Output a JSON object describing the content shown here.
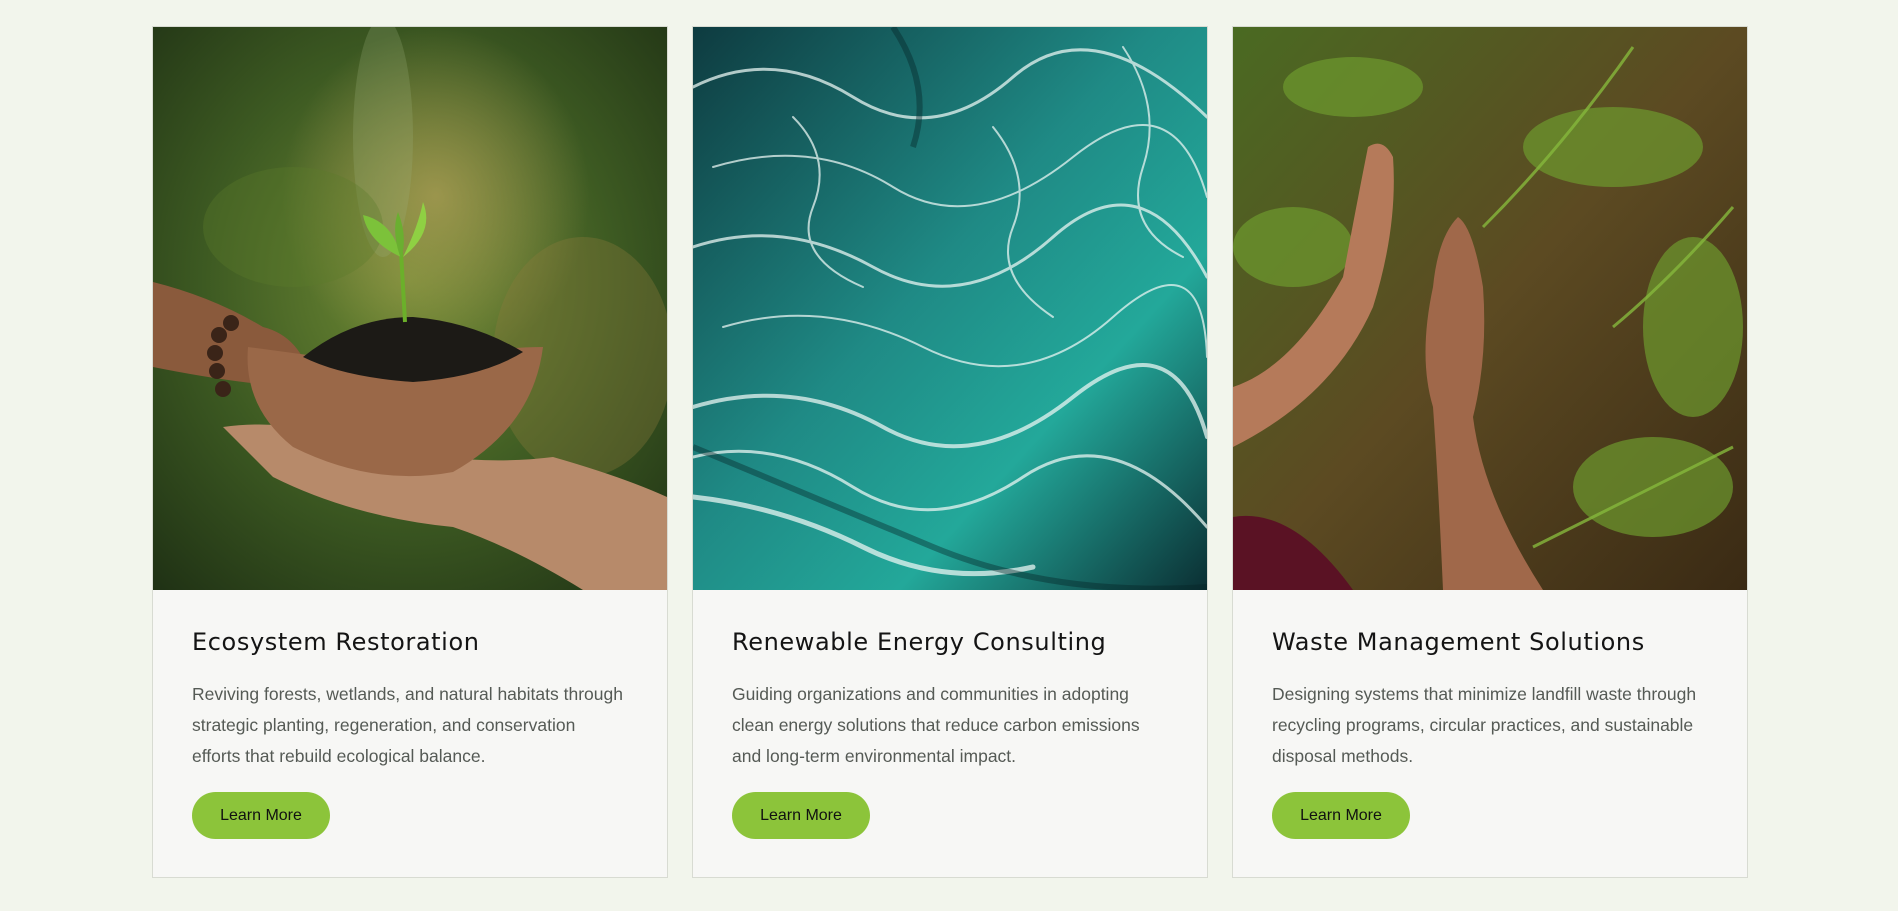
{
  "services": [
    {
      "image_alt": "Hands holding soil with a green seedling",
      "title": "Ecosystem Restoration",
      "description": "Reviving forests, wetlands, and natural habitats through strategic planting, regeneration, and conservation efforts that rebuild ecological balance.",
      "button_label": "Learn More"
    },
    {
      "image_alt": "Aerial view of turquoise ocean water with white foam",
      "title": "Renewable Energy Consulting",
      "description": "Guiding organizations and communities in adopting clean energy solutions that reduce carbon emissions and long-term environmental impact.",
      "button_label": "Learn More"
    },
    {
      "image_alt": "Hands touching green ferns on a mossy wall",
      "title": "Waste Management Solutions",
      "description": "Designing systems that minimize landfill waste through recycling programs, circular practices, and sustainable disposal methods.",
      "button_label": "Learn More"
    }
  ],
  "colors": {
    "page_background": "#f2f5ec",
    "card_background": "#f7f7f5",
    "button_accent": "#8cc43a"
  }
}
